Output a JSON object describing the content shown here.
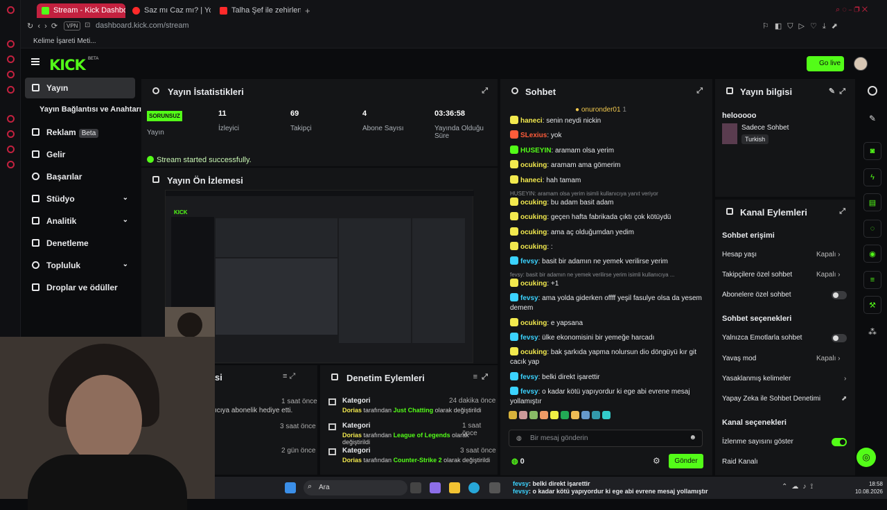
{
  "browser": {
    "tabs": [
      {
        "label": "Stream - Kick Dashboard"
      },
      {
        "label": "Saz mı Caz mı? | YouTu"
      },
      {
        "label": "Talha Şef ile zehirlenme ga"
      }
    ],
    "url_host": "dashboard.kick.com",
    "url_path": "/stream",
    "vpn": "VPN",
    "bookmark": "Kelime İşareti Meti..."
  },
  "header": {
    "logo": "KICK",
    "beta": "BETA",
    "go_live": "Go live"
  },
  "sidebar": {
    "items": [
      {
        "label": "Yayın"
      },
      {
        "label": "Yayın Bağlantısı ve Anahtarı"
      },
      {
        "label": "Reklam",
        "badge": "Beta"
      },
      {
        "label": "Gelir"
      },
      {
        "label": "Başarılar"
      },
      {
        "label": "Stüdyo"
      },
      {
        "label": "Analitik"
      },
      {
        "label": "Denetleme"
      },
      {
        "label": "Topluluk"
      },
      {
        "label": "Droplar ve ödüller"
      }
    ]
  },
  "stats": {
    "title": "Yayın İstatistikleri",
    "status": "SORUNSUZ",
    "status_label": "Yayın",
    "items": [
      {
        "value": "11",
        "label": "İzleyici"
      },
      {
        "value": "69",
        "label": "Takipçi"
      },
      {
        "value": "4",
        "label": "Abone Sayısı"
      },
      {
        "value": "03:36:58",
        "label": "Yayında Olduğu Süre"
      }
    ],
    "success": "Stream started successfully."
  },
  "preview": {
    "title": "Yayın Ön İzlemesi"
  },
  "activity": {
    "title": "si",
    "rows": [
      {
        "text": "ıcıya abonelik hediye etti.",
        "time": "1 saat önce"
      },
      {
        "text": "",
        "time": "3 saat önce"
      },
      {
        "text": "",
        "time": "2 gün önce"
      }
    ]
  },
  "mod": {
    "title": "Denetim Eylemleri",
    "rows": [
      {
        "kind": "Kategori",
        "user": "Dorias",
        "mid": " tarafından ",
        "cat": "Just Chatting",
        "end": " olarak değiştirildi",
        "time": "24 dakika önce"
      },
      {
        "kind": "Kategori",
        "user": "Dorias",
        "mid": " tarafından ",
        "cat": "League of Legends",
        "end": " olarak değiştirildi",
        "time": "1 saat önce"
      },
      {
        "kind": "Kategori",
        "user": "Dorias",
        "mid": " tarafından ",
        "cat": "Counter-Strike 2",
        "end": " olarak değiştirildi",
        "time": "3 saat önce"
      }
    ]
  },
  "chat": {
    "title": "Sohbet",
    "pinned": "onuronder01",
    "pinned_count": "1",
    "messages": [
      {
        "user": "haneci",
        "text": "senin neydi nickin",
        "color": "#f2e94e"
      },
      {
        "user": "SLexius",
        "text": "yok",
        "color": "#ff5c3a"
      },
      {
        "user": "HUSEYIN",
        "text": "aramam olsa yerim",
        "color": "#53fc18"
      },
      {
        "user": "ocuking",
        "text": "aramam ama gömerim",
        "color": "#f2e94e"
      },
      {
        "user": "haneci",
        "text": "hah tamam",
        "color": "#f2e94e"
      },
      {
        "reply": "HUSEYIN: aramam olsa yerim isimli kullanıcıya yanıt veriyor"
      },
      {
        "user": "ocuking",
        "text": "bu adam basit adam",
        "color": "#f2e94e"
      },
      {
        "user": "ocuking",
        "text": "geçen hafta fabrikada çıktı çok kötüydü",
        "color": "#f2e94e"
      },
      {
        "user": "ocuking",
        "text": "ama aç olduğumdan yedim",
        "color": "#f2e94e"
      },
      {
        "user": "ocuking",
        "text": ":",
        "color": "#f2e94e"
      },
      {
        "user": "fevsy",
        "text": "basit bir adamın ne yemek verilirse yerim",
        "color": "#3bd3ff"
      },
      {
        "reply": "fevsy: basit bir adamın ne yemek verilirse yerim isimli kullanıcıya ..."
      },
      {
        "user": "ocuking",
        "text": "+1",
        "color": "#f2e94e"
      },
      {
        "user": "fevsy",
        "text": "ama yolda giderken offff yeşil fasulye olsa da yesem demem",
        "color": "#3bd3ff"
      },
      {
        "user": "ocuking",
        "text": "e yapsana",
        "color": "#f2e94e"
      },
      {
        "user": "fevsy",
        "text": "ülke ekonomisini bir yemeğe harcadı",
        "color": "#3bd3ff"
      },
      {
        "user": "ocuking",
        "text": "bak şarkıda yapma nolursun dio döngüyü kır git cacık yap",
        "color": "#f2e94e"
      },
      {
        "user": "fevsy",
        "text": "belki direkt işarettir",
        "color": "#3bd3ff"
      },
      {
        "user": "fevsy",
        "text": "o kadar kötü yapıyordur ki ege abi evrene mesaj yollamıştır",
        "color": "#3bd3ff"
      }
    ],
    "placeholder": "Bir mesaj gönderin",
    "points": "0",
    "send": "Gönder"
  },
  "info": {
    "title": "Yayın bilgisi",
    "stream_title": "helooooo",
    "category": "Sadece Sohbet",
    "language": "Turkish"
  },
  "channel": {
    "title": "Kanal Eylemleri",
    "chat_access": "Sohbet erişimi",
    "rows": [
      {
        "label": "Hesap yaşı",
        "value": "Kapalı"
      },
      {
        "label": "Takipçilere özel sohbet",
        "value": "Kapalı"
      },
      {
        "label": "Abonelere özel sohbet"
      }
    ],
    "chat_opts": "Sohbet seçenekleri",
    "rows2": [
      {
        "label": "Yalnızca Emotlarla sohbet"
      },
      {
        "label": "Yavaş mod",
        "value": "Kapalı"
      },
      {
        "label": "Yasaklanmış kelimeler"
      },
      {
        "label": "Yapay Zeka ile Sohbet Denetimi"
      }
    ],
    "ch_opts": "Kanal seçenekleri",
    "rows3": [
      {
        "label": "İzlenme sayısını göster"
      },
      {
        "label": "Raid Kanalı"
      }
    ]
  },
  "taskbar": {
    "search": "Ara",
    "time": "18:58",
    "date": "10.08.2026",
    "overlay": [
      {
        "user": "fevsy",
        "text": ": belki direkt işarettir"
      },
      {
        "user": "fevsy",
        "text": ": o kadar kötü yapıyordur ki ege abi evrene mesaj yollamıştır"
      }
    ]
  }
}
